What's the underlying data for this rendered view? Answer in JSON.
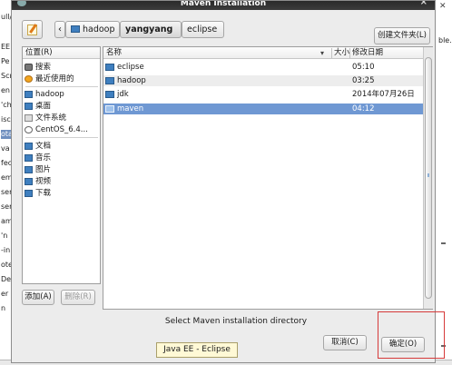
{
  "background_window": {
    "left_fragments": [
      "ull/",
      "EE",
      "Pe",
      "Scr",
      "en",
      "'ch",
      "isc",
      "ota",
      "va",
      "fec",
      "emi",
      "ser",
      "ser",
      "am",
      "'n",
      "-in",
      "ote",
      "Del",
      "er",
      "n"
    ],
    "right_fragments": [
      "ble."
    ]
  },
  "dialog": {
    "title": "Maven Installation",
    "create_folder_label": "创建文件夹(L)",
    "breadcrumbs": [
      "hadoop",
      "yangyang",
      "eclipse"
    ],
    "places_header": "位置(R)",
    "places": [
      {
        "label": "搜索",
        "icon": "search-icon"
      },
      {
        "label": "最近使用的",
        "icon": "recent-icon"
      },
      {
        "label": "hadoop",
        "icon": "folder-icon"
      },
      {
        "label": "桌面",
        "icon": "desktop-icon"
      },
      {
        "label": "文件系统",
        "icon": "filesystem-icon"
      },
      {
        "label": "CentOS_6.4...",
        "icon": "disc-icon"
      },
      {
        "label": "文档",
        "icon": "folder-icon"
      },
      {
        "label": "音乐",
        "icon": "folder-icon"
      },
      {
        "label": "图片",
        "icon": "folder-icon"
      },
      {
        "label": "视频",
        "icon": "folder-icon"
      },
      {
        "label": "下载",
        "icon": "folder-icon"
      }
    ],
    "add_label": "添加(A)",
    "remove_label": "删除(R)",
    "columns": {
      "name": "名称",
      "size": "大小",
      "modified": "修改日期"
    },
    "files": [
      {
        "name": "eclipse",
        "modified": "05:10"
      },
      {
        "name": "hadoop",
        "modified": "03:25"
      },
      {
        "name": "jdk",
        "modified": "2014年07月26日"
      },
      {
        "name": "maven",
        "modified": "04:12"
      }
    ],
    "selected_file": "maven",
    "status_text": "Select Maven installation directory",
    "cancel_label": "取消(C)",
    "ok_label": "确定(O)",
    "tooltip": "Java EE - Eclipse"
  },
  "colors": {
    "selection": "#6f98d3",
    "highlight_box": "#d63a3a"
  }
}
